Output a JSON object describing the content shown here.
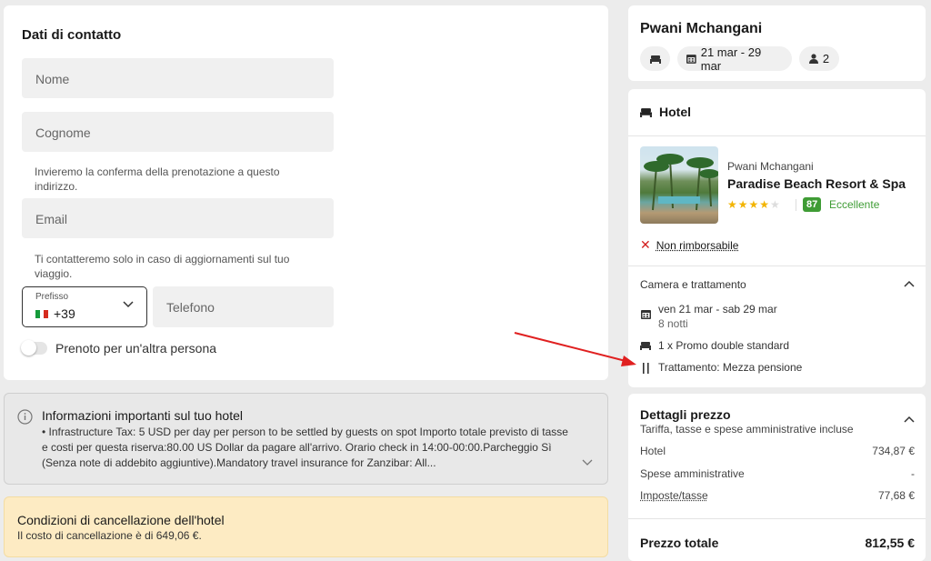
{
  "contact": {
    "title": "Dati di contatto",
    "name_placeholder": "Nome",
    "surname_placeholder": "Cognome",
    "email_hint": "Invieremo la conferma della prenotazione a questo indirizzo.",
    "email_placeholder": "Email",
    "phone_hint": "Ti contatteremo solo in caso di aggiornamenti sul tuo viaggio.",
    "prefix_label": "Prefisso",
    "prefix_value": "+39",
    "phone_placeholder": "Telefono",
    "other_person_label": "Prenoto per un'altra persona"
  },
  "info": {
    "title": "Informazioni importanti sul tuo hotel",
    "body": "• Infrastructure Tax: 5 USD per day per person to be settled by guests on spot Importo totale previsto di tasse e costi per questa riserva:80.00 US Dollar da pagare all'arrivo. Orario check in 14:00-00:00.Parcheggio Sì (Senza note di addebito aggiuntive).Mandatory travel insurance for Zanzibar: All..."
  },
  "cancellation": {
    "title": "Condizioni di cancellazione dell'hotel",
    "body": "Il costo di cancellazione è di 649,06 €."
  },
  "summary": {
    "destination": "Pwani Mchangani",
    "dates": "21 mar - 29 mar",
    "guests": "2"
  },
  "hotel": {
    "section_title": "Hotel",
    "location": "Pwani Mchangani",
    "name": "Paradise Beach Resort & Spa",
    "stars": "★★★★",
    "stars_off": "★",
    "rating": "87",
    "rating_label": "Eccellente",
    "refund_policy": "Non rimborsabile",
    "room_section": "Camera e trattamento",
    "stay_dates": "ven 21 mar - sab 29 mar",
    "nights": "8 notti",
    "room": "1 x Promo double standard",
    "board": "Trattamento: Mezza pensione"
  },
  "price": {
    "title": "Dettagli prezzo",
    "subtitle": "Tariffa, tasse e spese amministrative incluse",
    "rows": [
      {
        "label": "Hotel",
        "value": "734,87 €"
      },
      {
        "label": "Spese amministrative",
        "value": "-"
      },
      {
        "label": "Imposte/tasse",
        "value": "77,68 €"
      }
    ],
    "total_label": "Prezzo totale",
    "total_value": "812,55 €"
  },
  "colors": {
    "accent_green": "#3f9c35",
    "star": "#f2b400",
    "error_red": "#d21f1f",
    "warning_bg": "#fdebc3"
  }
}
